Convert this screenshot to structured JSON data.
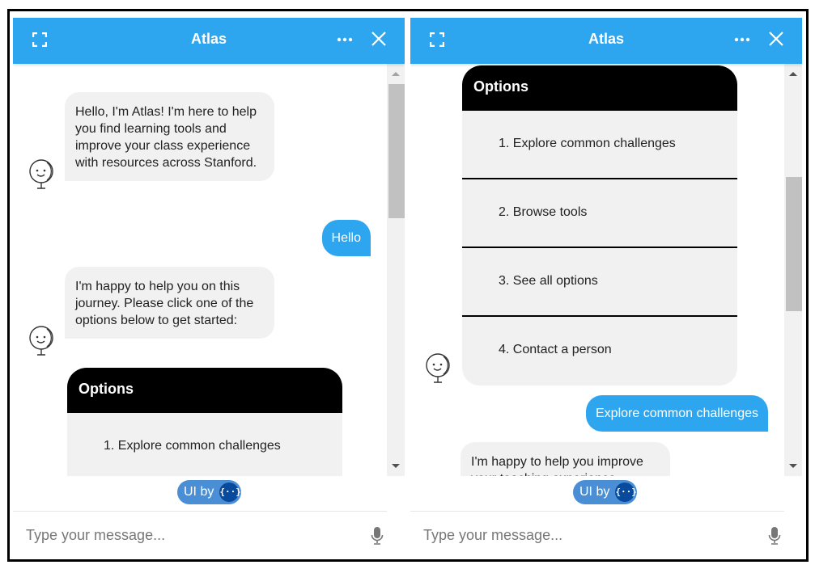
{
  "panels": [
    {
      "header": {
        "title": "Atlas",
        "expand_icon": "expand-icon",
        "more_icon": "more-horizontal-icon",
        "close_icon": "close-icon"
      },
      "messages": [
        {
          "from": "bot",
          "text": "Hello, I'm Atlas! I'm here to help you find learning tools and improve your class experience with resources across Stanford."
        },
        {
          "from": "user",
          "text": "Hello"
        },
        {
          "from": "bot",
          "text": "I'm happy to help you on this journey. Please click one of the options below to get started:"
        }
      ],
      "options": {
        "title": "Options",
        "items": [
          "1. Explore common challenges"
        ]
      },
      "scroll_position": 0.0,
      "badge": {
        "label": "UI by",
        "logo": "{··}"
      },
      "composer": {
        "placeholder": "Type your message...",
        "mic_icon": "microphone-icon"
      }
    },
    {
      "header": {
        "title": "Atlas",
        "expand_icon": "expand-icon",
        "more_icon": "more-horizontal-icon",
        "close_icon": "close-icon"
      },
      "options": {
        "title": "Options",
        "items": [
          "1. Explore common challenges",
          "2. Browse tools",
          "3. See all options",
          "4. Contact a person"
        ]
      },
      "messages": [
        {
          "from": "user",
          "text": "Explore common challenges"
        },
        {
          "from": "bot",
          "text": "I'm happy to help you improve your teaching experience"
        }
      ],
      "scroll_position": 0.35,
      "badge": {
        "label": "UI by",
        "logo": "{··}"
      },
      "composer": {
        "placeholder": "Type your message...",
        "mic_icon": "microphone-icon"
      }
    }
  ],
  "colors": {
    "header": "#2ea6ef",
    "user_bubble": "#2ea6ef",
    "bot_bubble": "#f1f1f1",
    "options_header": "#000000",
    "badge": "#4a8fd6"
  }
}
